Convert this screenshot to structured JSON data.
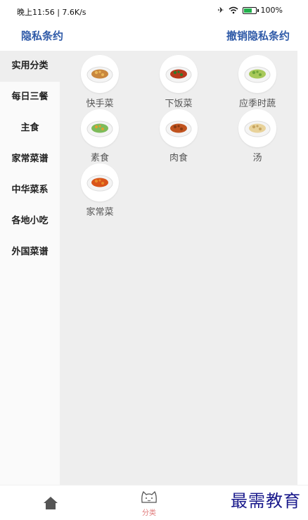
{
  "status": {
    "time_speed": "晚上11:56 | 7.6K/s",
    "battery": "100%",
    "battery_level": 0.85
  },
  "header": {
    "privacy_link": "隐私条约",
    "revoke_link": "撤销隐私条约"
  },
  "sidebar": {
    "items": [
      "实用分类",
      "每日三餐",
      "主食",
      "家常菜谱",
      "中华菜系",
      "各地小吃",
      "外国菜谱"
    ],
    "active_index": 0
  },
  "grid": {
    "items": [
      {
        "label": "快手菜",
        "dish": "#c9873e",
        "garnish": "#e8b75a"
      },
      {
        "label": "下饭菜",
        "dish": "#b83a1e",
        "garnish": "#2f7d2a"
      },
      {
        "label": "应季时蔬",
        "dish": "#a8c95a",
        "garnish": "#6ea53a"
      },
      {
        "label": "素食",
        "dish": "#7dbb5a",
        "garnish": "#e0a030"
      },
      {
        "label": "肉食",
        "dish": "#c0531e",
        "garnish": "#8a3a12"
      },
      {
        "label": "汤",
        "dish": "#e8d29a",
        "garnish": "#c7a560"
      },
      {
        "label": "家常菜",
        "dish": "#d9541a",
        "garnish": "#e88a2a"
      }
    ]
  },
  "bottom": {
    "category_label": "分类"
  },
  "watermark": "最需教育",
  "colors": {
    "accent": "#2f5aa8",
    "tab_active": "#e07a7a"
  }
}
